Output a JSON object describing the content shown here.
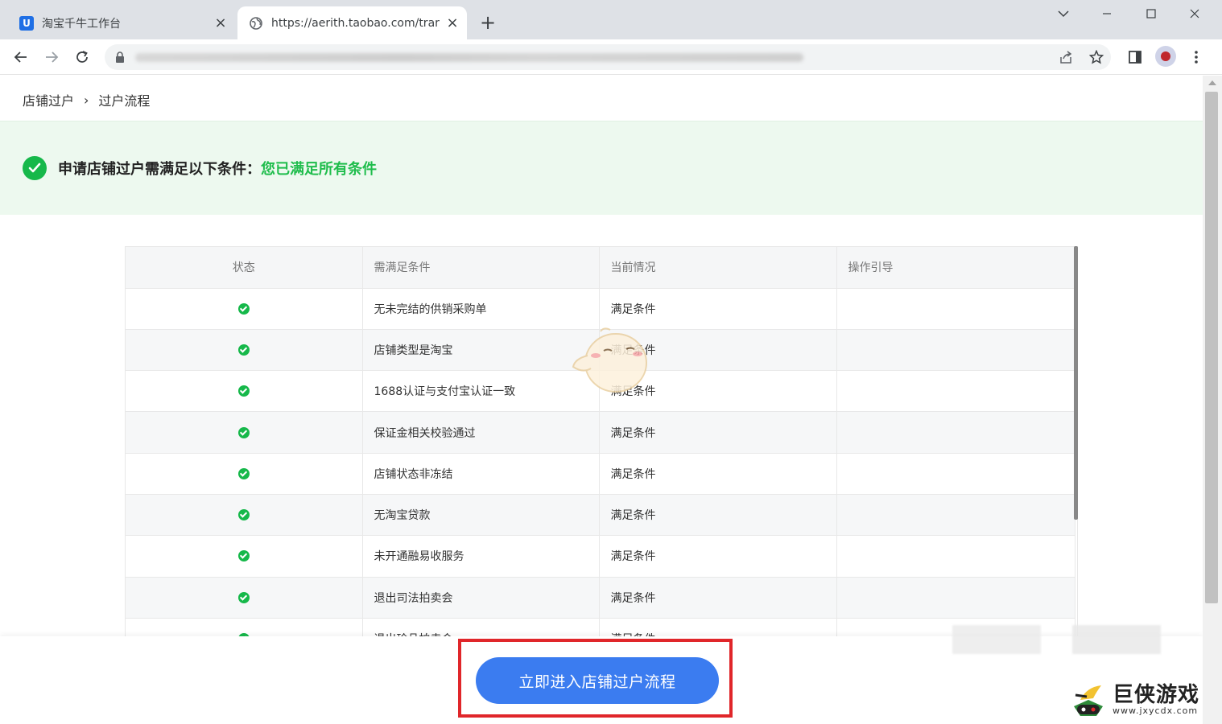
{
  "browser": {
    "tabs": [
      {
        "title": "淘宝千牛工作台",
        "favicon": "qianniu-icon",
        "active": false
      },
      {
        "title": "https://aerith.taobao.com/trar",
        "favicon": "globe-icon",
        "active": true
      }
    ],
    "new_tab_label": "+",
    "address_bar": {
      "url_visible": false
    }
  },
  "page": {
    "breadcrumb": {
      "items": [
        "店铺过户",
        "过户流程"
      ],
      "separator": "›"
    },
    "notice": {
      "text": "申请店铺过户需满足以下条件：",
      "status": "您已满足所有条件",
      "status_color": "#1fbd4c"
    },
    "table": {
      "headers": [
        "状态",
        "需满足条件",
        "当前情况",
        "操作引导"
      ],
      "rows": [
        {
          "status": "ok",
          "condition": "无未完结的供销采购单",
          "current": "满足条件",
          "guide": ""
        },
        {
          "status": "ok",
          "condition": "店铺类型是淘宝",
          "current": "满足条件",
          "guide": ""
        },
        {
          "status": "ok",
          "condition": "1688认证与支付宝认证一致",
          "current": "满足条件",
          "guide": ""
        },
        {
          "status": "ok",
          "condition": "保证金相关校验通过",
          "current": "满足条件",
          "guide": ""
        },
        {
          "status": "ok",
          "condition": "店铺状态非冻结",
          "current": "满足条件",
          "guide": ""
        },
        {
          "status": "ok",
          "condition": "无淘宝贷款",
          "current": "满足条件",
          "guide": ""
        },
        {
          "status": "ok",
          "condition": "未开通融易收服务",
          "current": "满足条件",
          "guide": ""
        },
        {
          "status": "ok",
          "condition": "退出司法拍卖会",
          "current": "满足条件",
          "guide": ""
        },
        {
          "status": "ok",
          "condition": "退出珍品拍卖会",
          "current": "满足条件",
          "guide": ""
        }
      ]
    },
    "cta": {
      "label": "立即进入店铺过户流程",
      "highlight_color": "#e0262a",
      "button_color": "#3b7cf0"
    }
  },
  "watermark": {
    "name": "巨侠游戏",
    "url": "www.jxycdx.com"
  },
  "colors": {
    "success": "#16b84a",
    "accent": "#3b7cf0",
    "notice_bg": "#edf9ef"
  }
}
